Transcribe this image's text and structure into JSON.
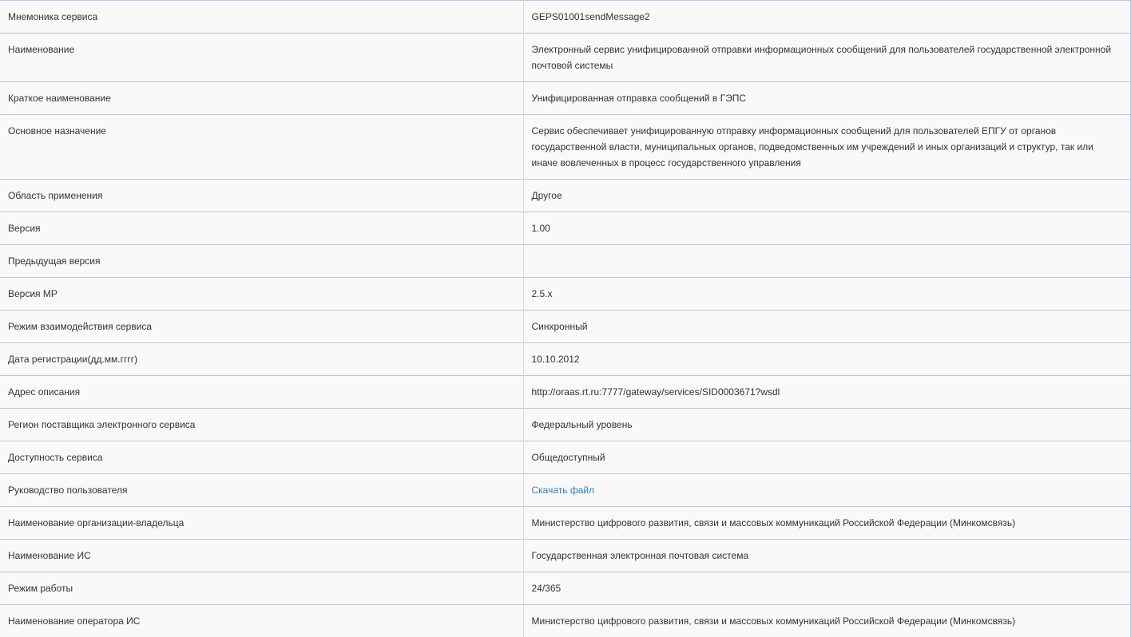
{
  "rows": [
    {
      "label": "Мнемоника сервиса",
      "value": "GEPS01001sendMessage2"
    },
    {
      "label": "Наименование",
      "value": "Электронный сервис унифицированной отправки информационных сообщений для пользователей государственной электронной почтовой системы"
    },
    {
      "label": "Краткое наименование",
      "value": "Унифицированная отправка сообщений в ГЭПС"
    },
    {
      "label": "Основное назначение",
      "value": "Сервис обеспечивает унифицированную отправку информационных сообщений для пользователей ЕПГУ от органов государственной власти, муниципальных органов, подведомственных им учреждений и иных организаций и структур, так или иначе вовлеченных в процесс государственного управления"
    },
    {
      "label": "Область применения",
      "value": "Другое"
    },
    {
      "label": "Версия",
      "value": "1.00"
    },
    {
      "label": "Предыдущая версия",
      "value": ""
    },
    {
      "label": "Версия МР",
      "value": "2.5.x"
    },
    {
      "label": "Режим взаимодействия сервиса",
      "value": "Синхронный"
    },
    {
      "label": "Дата регистрации(дд.мм.гггг)",
      "value": "10.10.2012"
    },
    {
      "label": "Адрес описания",
      "value": "http://oraas.rt.ru:7777/gateway/services/SID0003671?wsdl"
    },
    {
      "label": "Регион поставщика электронного сервиса",
      "value": "Федеральный уровень"
    },
    {
      "label": "Доступность сервиса",
      "value": "Общедоступный"
    },
    {
      "label": "Руководство пользователя",
      "value": "Скачать файл",
      "is_link": true
    },
    {
      "label": "Наименование организации-владельца",
      "value": "Министерство цифрового развития, связи и массовых коммуникаций Российской Федерации (Минкомсвязь)"
    },
    {
      "label": "Наименование ИС",
      "value": "Государственная электронная почтовая система"
    },
    {
      "label": "Режим работы",
      "value": "24/365"
    },
    {
      "label": "Наименование оператора ИС",
      "value": "Министерство цифрового развития, связи и массовых коммуникаций Российской Федерации (Минкомсвязь)"
    }
  ],
  "colors": {
    "border": "#b3c8df",
    "link": "#2a7ec2",
    "text": "#333333",
    "background": "#f9f9f9"
  }
}
